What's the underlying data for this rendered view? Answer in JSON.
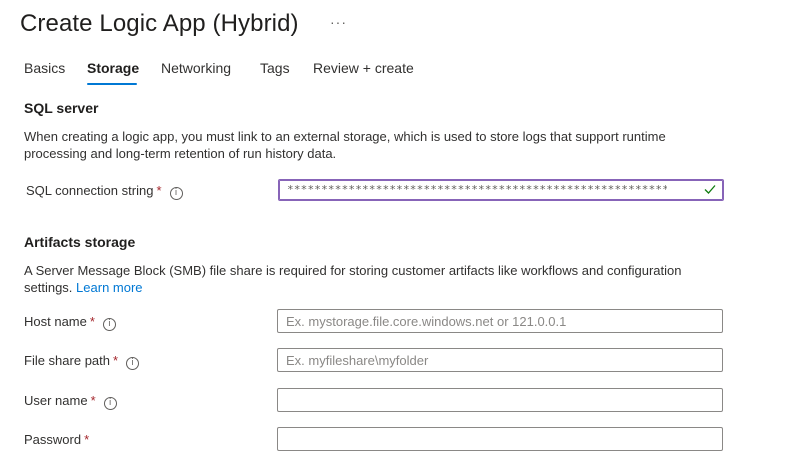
{
  "header": {
    "title": "Create Logic App (Hybrid)",
    "more_label": "···"
  },
  "tabs": [
    {
      "label": "Basics",
      "active": false
    },
    {
      "label": "Storage",
      "active": true
    },
    {
      "label": "Networking",
      "active": false
    },
    {
      "label": "Tags",
      "active": false
    },
    {
      "label": "Review + create",
      "active": false
    }
  ],
  "sql_section": {
    "title": "SQL server",
    "description": "When creating a logic app, you must link to an external storage, which is used to store logs that support runtime processing and long-term retention of run history data.",
    "connection_string": {
      "label": "SQL connection string",
      "required_mark": "*",
      "info_glyph": "i",
      "value_masked": "************************************************************************",
      "status_icon": "checkmark-icon"
    }
  },
  "artifacts_section": {
    "title": "Artifacts storage",
    "description": "A Server Message Block (SMB) file share is required for storing customer artifacts like workflows and configuration settings.",
    "learn_more": "Learn more",
    "fields": {
      "host_name": {
        "label": "Host name",
        "required_mark": "*",
        "info_glyph": "i",
        "placeholder": "Ex. mystorage.file.core.windows.net or 121.0.0.1",
        "value": ""
      },
      "file_share_path": {
        "label": "File share path",
        "required_mark": "*",
        "info_glyph": "i",
        "placeholder": "Ex. myfileshare\\myfolder",
        "value": ""
      },
      "user_name": {
        "label": "User name",
        "required_mark": "*",
        "info_glyph": "i",
        "placeholder": "",
        "value": ""
      },
      "password": {
        "label": "Password",
        "required_mark": "*",
        "placeholder": "",
        "value": ""
      }
    }
  },
  "colors": {
    "accent": "#0078d4",
    "focus_border": "#8764b8",
    "required": "#a4262c",
    "success": "#107c10"
  }
}
